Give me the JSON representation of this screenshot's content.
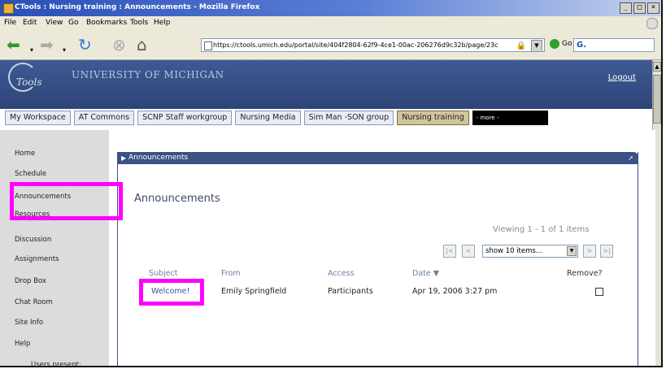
{
  "window": {
    "title": "CTools : Nursing training : Announcements - Mozilla Firefox",
    "buttons": [
      "_",
      "□",
      "×"
    ]
  },
  "menu": [
    "File",
    "Edit",
    "View",
    "Go",
    "Bookmarks",
    "Tools",
    "Help"
  ],
  "navbar": {
    "url": "https://ctools.umich.edu/portal/site/404f2804-62f9-4ce1-00ac-206276d9c32b/page/23c",
    "go_label": "Go",
    "search_value": "G."
  },
  "header": {
    "logo_text": "Tools",
    "university": "UNIVERSITY OF MICHIGAN",
    "logout": "Logout"
  },
  "tabs": [
    {
      "label": "My Workspace"
    },
    {
      "label": "AT Commons"
    },
    {
      "label": "SCNP Staff workgroup"
    },
    {
      "label": "Nursing Media"
    },
    {
      "label": "Sim Man -SON group"
    },
    {
      "label": "Nursing training",
      "active": true
    },
    {
      "label": "- more -"
    }
  ],
  "sidebar": {
    "items": [
      {
        "label": "Home"
      },
      {
        "label": "Schedule"
      },
      {
        "label": "Announcements"
      },
      {
        "label": "Resources"
      },
      {
        "label": "Discussion"
      },
      {
        "label": "Assignments"
      },
      {
        "label": "Drop Box"
      },
      {
        "label": "Chat Room"
      },
      {
        "label": "Site Info"
      },
      {
        "label": "Help"
      },
      {
        "label": "Users present:"
      }
    ]
  },
  "portlet": {
    "title": "Announcements",
    "heading": "Announcements",
    "viewing": "Viewing 1 - 1 of 1 items",
    "page_size": "show 10 items...",
    "columns": [
      "Subject",
      "From",
      "Access",
      "Date ▼",
      "Remove?"
    ],
    "rows": [
      {
        "subject": "Welcome!",
        "from": "Emily Springfield",
        "access": "Participants",
        "date": "Apr 19, 2006 3:27 pm"
      }
    ]
  },
  "colors": {
    "highlight": "#ff00ff",
    "header_blue": "#3b5286",
    "active_tab": "#d2c49c"
  }
}
